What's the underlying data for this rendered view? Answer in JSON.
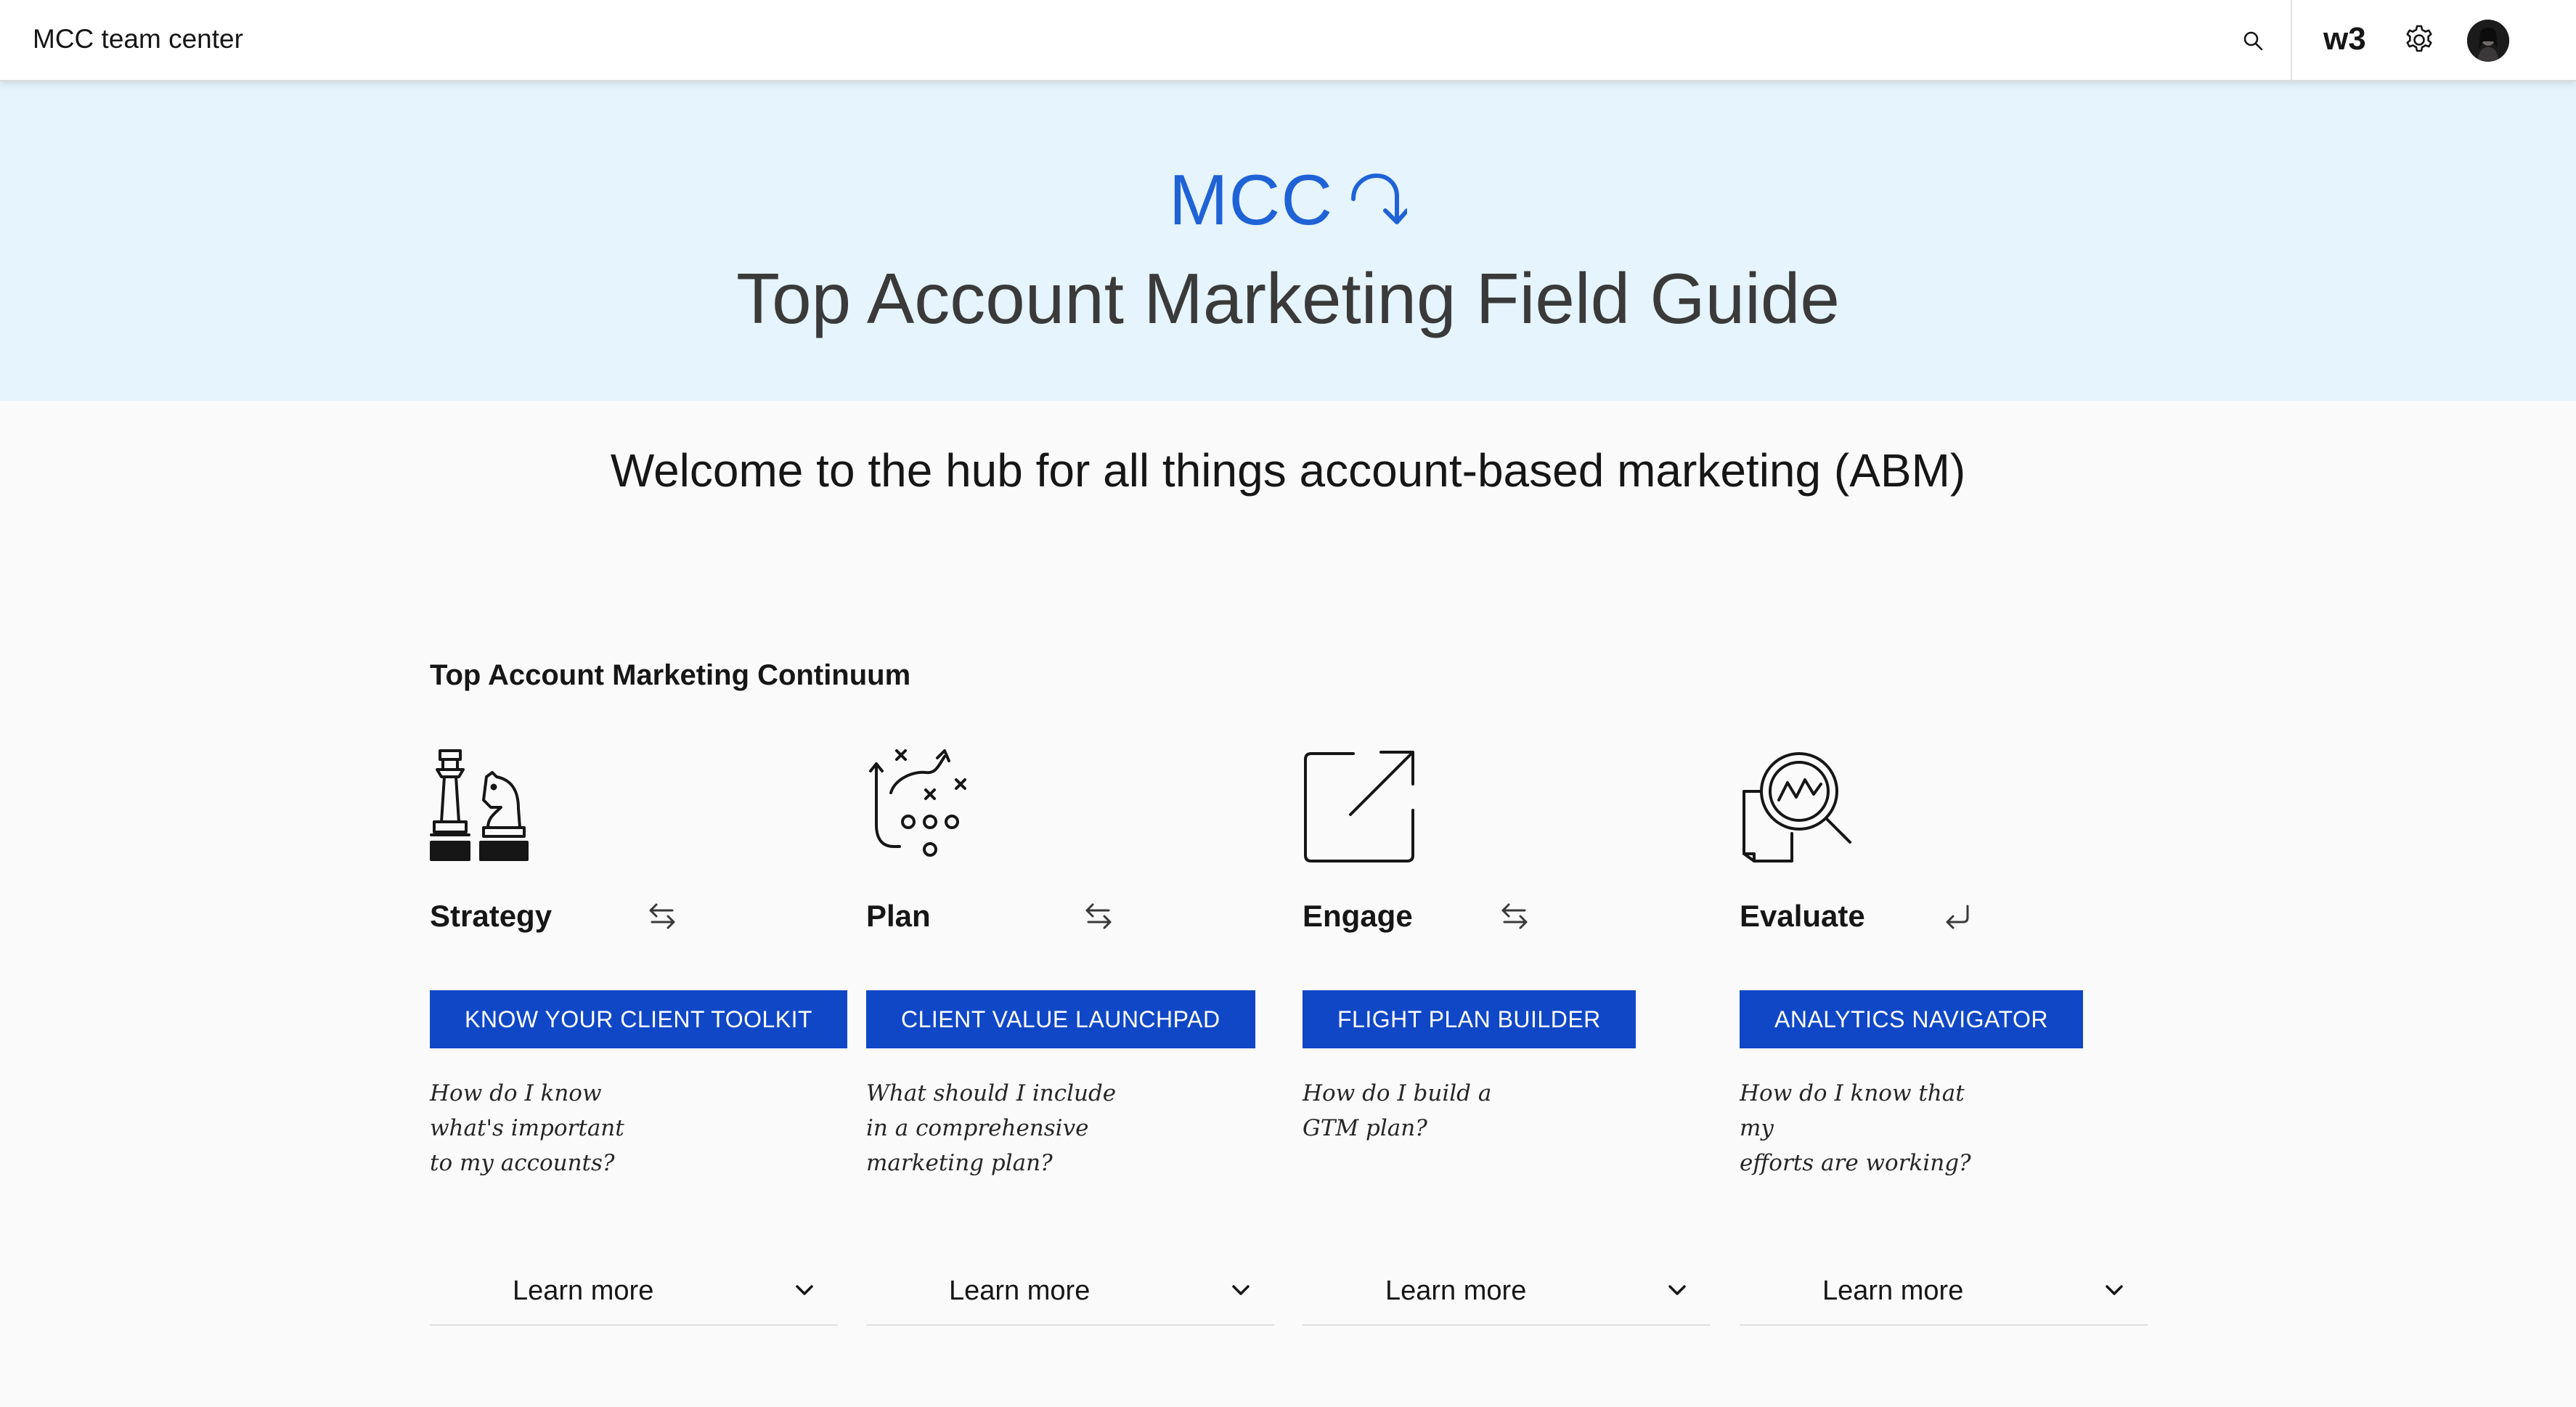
{
  "header": {
    "app_name": "MCC team center",
    "brand": "w3"
  },
  "hero": {
    "brand": "MCC",
    "title": "Top Account Marketing Field Guide",
    "accent_color": "#1f62d6",
    "background_color": "#e5f4fd"
  },
  "welcome": "Welcome to the hub for all things account-based marketing (ABM)",
  "section": {
    "title": "Top Account Marketing Continuum",
    "stages": [
      {
        "label": "Strategy",
        "icon": "chess-icon",
        "flow_icon": "bidirectional-arrows-icon",
        "cta": "KNOW YOUR CLIENT TOOLKIT",
        "question_lines": [
          "How do I know",
          "what's important",
          "to my accounts?"
        ],
        "learn_more": "Learn more"
      },
      {
        "label": "Plan",
        "icon": "play-strategy-icon",
        "flow_icon": "bidirectional-arrows-icon",
        "cta": "CLIENT VALUE LAUNCHPAD",
        "question_lines": [
          "What should I include",
          "in a comprehensive",
          "marketing plan?"
        ],
        "learn_more": "Learn more"
      },
      {
        "label": "Engage",
        "icon": "launch-icon",
        "flow_icon": "bidirectional-arrows-icon",
        "cta": "FLIGHT PLAN BUILDER",
        "question_lines": [
          "How do I build a",
          "GTM plan?"
        ],
        "learn_more": "Learn more"
      },
      {
        "label": "Evaluate",
        "icon": "analytics-icon",
        "flow_icon": "return-arrow-icon",
        "cta": "ANALYTICS NAVIGATOR",
        "question_lines": [
          "How do I know that my",
          "efforts are working?"
        ],
        "learn_more": "Learn more"
      }
    ],
    "button_color": "#0f47c7"
  }
}
